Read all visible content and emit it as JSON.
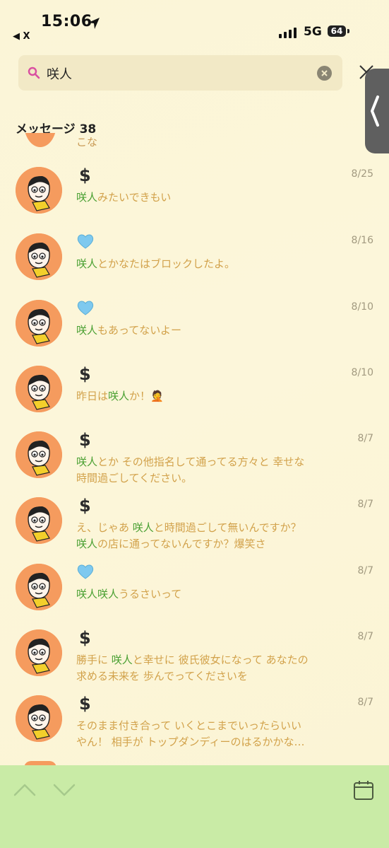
{
  "status_bar": {
    "time": "15:06",
    "back_app": "◀ X",
    "network": "5G",
    "battery": "64"
  },
  "search": {
    "query": "咲人"
  },
  "results": {
    "title": "メッセージ 38",
    "peek_text": "こな"
  },
  "messages": [
    {
      "name_icon": "dollar",
      "date": "8/25",
      "lines": [
        [
          {
            "t": "咲人",
            "hl": true
          },
          {
            "t": "みたいできもい"
          }
        ]
      ]
    },
    {
      "name_icon": "blue-heart",
      "date": "8/16",
      "lines": [
        [
          {
            "t": "咲人",
            "hl": true
          },
          {
            "t": "とかなたはブロックしたよ。"
          }
        ]
      ]
    },
    {
      "name_icon": "blue-heart",
      "date": "8/10",
      "lines": [
        [
          {
            "t": "咲人",
            "hl": true
          },
          {
            "t": "もあってないよー"
          }
        ]
      ]
    },
    {
      "name_icon": "dollar",
      "date": "8/10",
      "lines": [
        [
          {
            "t": "昨日は"
          },
          {
            "t": "咲人",
            "hl": true
          },
          {
            "t": "か！🤦"
          }
        ]
      ]
    },
    {
      "name_icon": "dollar",
      "date": "8/7",
      "lines": [
        [
          {
            "t": "咲人",
            "hl": true
          },
          {
            "t": "とか その他指名して通ってる方々と 幸せな"
          }
        ],
        [
          {
            "t": "時間過ごしてください。"
          }
        ]
      ]
    },
    {
      "name_icon": "dollar",
      "date": "8/7",
      "lines": [
        [
          {
            "t": "え、じゃあ "
          },
          {
            "t": "咲人",
            "hl": true
          },
          {
            "t": "と時間過ごして無いんですか？"
          }
        ],
        [
          {
            "t": "咲人",
            "hl": true
          },
          {
            "t": "の店に通ってないんですか？爆笑さ"
          }
        ]
      ]
    },
    {
      "name_icon": "blue-heart",
      "date": "8/7",
      "lines": [
        [
          {
            "t": "咲人咲人",
            "hl": true
          },
          {
            "t": "うるさいって"
          }
        ]
      ]
    },
    {
      "name_icon": "dollar",
      "date": "8/7",
      "lines": [
        [
          {
            "t": "勝手に "
          },
          {
            "t": "咲人",
            "hl": true
          },
          {
            "t": "と幸せに 彼氏彼女になって あなたの"
          }
        ],
        [
          {
            "t": "求める未来を 歩んでってくださいを"
          }
        ]
      ]
    },
    {
      "name_icon": "dollar",
      "date": "8/7",
      "lines": [
        [
          {
            "t": "そのまま付き合って いくとこまでいったらいい"
          }
        ],
        [
          {
            "t": "やん！ 相手が トップダンディーのはるかかな…"
          }
        ]
      ]
    }
  ],
  "colors": {
    "highlight": "#4aa032",
    "message_text": "#d2a24b",
    "avatar_bg": "#f59b5e",
    "bottom_bar": "#c9eba6"
  }
}
